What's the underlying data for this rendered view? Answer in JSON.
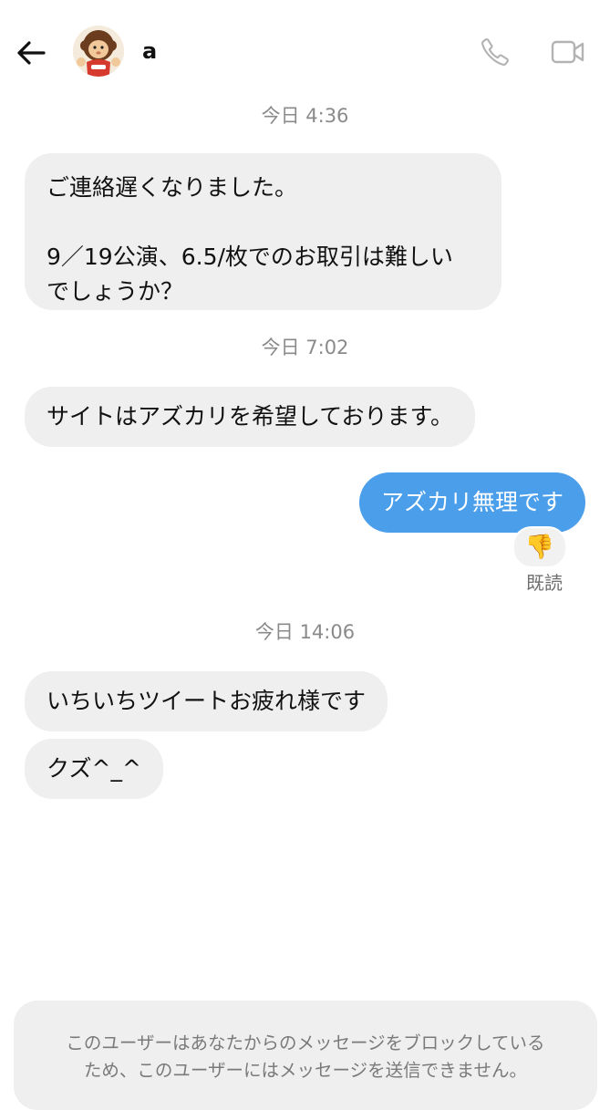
{
  "header": {
    "username": "a",
    "back_icon": "arrow-left-icon",
    "call_icon": "phone-icon",
    "video_icon": "video-camera-icon",
    "avatar_icon": "monchhichi-avatar"
  },
  "conversation": {
    "timestamps": [
      "今日 4:36",
      "今日 7:02",
      "今日 14:06"
    ],
    "messages": [
      {
        "direction": "incoming",
        "lines": [
          "ご連絡遅くなりました。",
          "",
          "9／19公演、6.5/枚でのお取引は難しい",
          "でしょうか？"
        ]
      },
      {
        "direction": "incoming",
        "lines": [
          "サイトはアズカリを希望しております。"
        ]
      },
      {
        "direction": "outgoing",
        "text": "アズカリ無理です",
        "reaction": "👎",
        "read_label": "既読"
      },
      {
        "direction": "incoming",
        "lines": [
          "いちいちツイートお疲れ様です"
        ]
      },
      {
        "direction": "incoming",
        "lines": [
          "クズ^_^"
        ]
      }
    ]
  },
  "blocked_notice": {
    "line1": "このユーザーはあなたからのメッセージをブロックしている",
    "line2": "ため、このユーザーにはメッセージを送信できません。"
  },
  "colors": {
    "incoming_bubble": "#efefef",
    "outgoing_bubble": "#4a9eea",
    "timestamp_text": "#8a8a8a",
    "icon_gray": "#b3b3b3"
  }
}
